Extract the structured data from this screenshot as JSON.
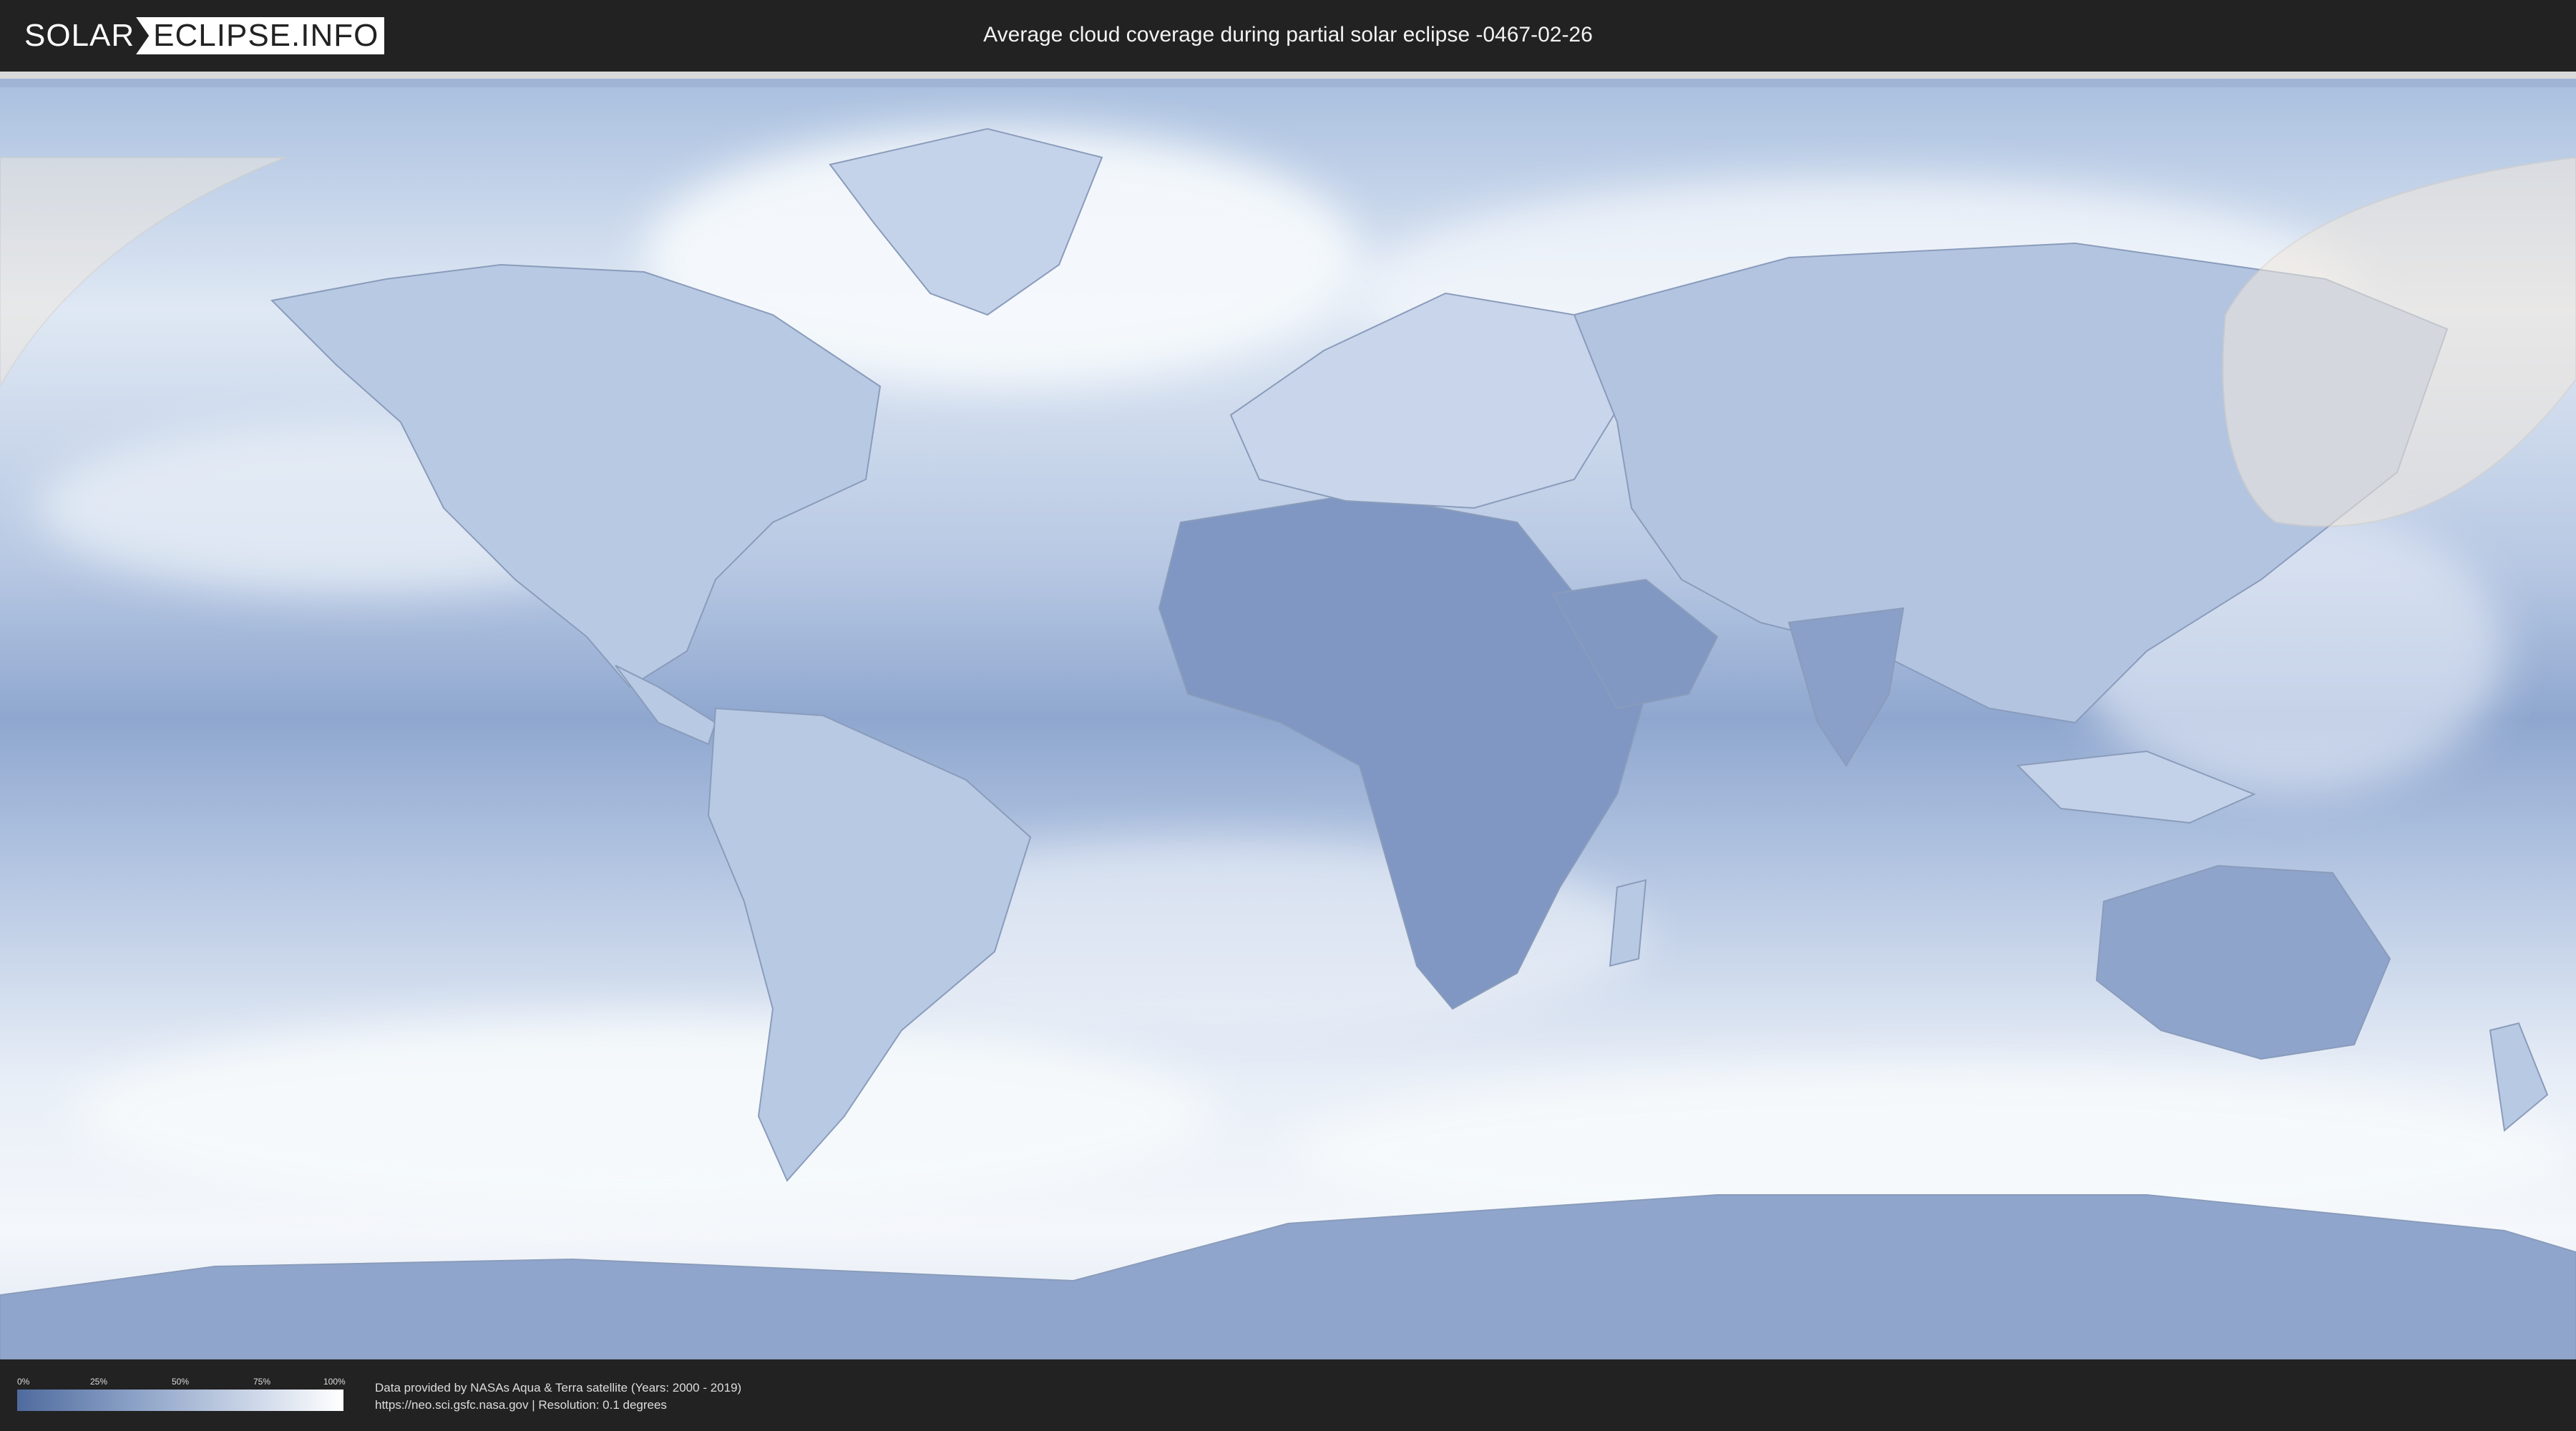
{
  "header": {
    "logo_left": "SOLAR",
    "logo_right": "ECLIPSE.INFO",
    "title": "Average cloud coverage during partial solar eclipse -0467-02-26"
  },
  "legend": {
    "ticks": [
      "0%",
      "25%",
      "50%",
      "75%",
      "100%"
    ],
    "gradient_start": "#4f6b9e",
    "gradient_end": "#ffffff"
  },
  "credits": {
    "line1": "Data provided by NASAs Aqua & Terra satellite (Years: 2000 - 2019)",
    "line2": "https://neo.sci.gsfc.nasa.gov | Resolution: 0.1 degrees"
  },
  "map": {
    "ocean_color": "#9fb4d6",
    "cloud_color": "#f4f7fb",
    "land_dark_color": "#6f87b6",
    "eclipse_overlay_color": "#f1e8dc"
  }
}
